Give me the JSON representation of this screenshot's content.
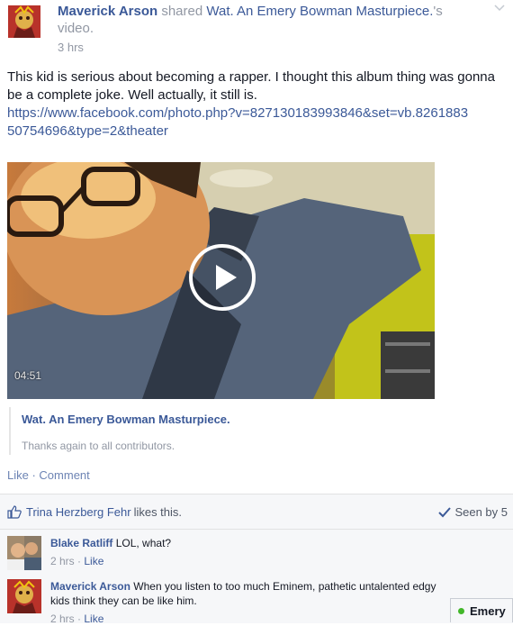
{
  "post": {
    "author": "Maverick Arson",
    "shared_text": " shared ",
    "page_name": "Wat. An Emery Bowman Masturpiece.",
    "video_suffix": "'s video.",
    "time": "3 hrs",
    "body": "This kid is serious about becoming a rapper. I thought this album thing was gonna be a complete joke. Well actually, it still is.",
    "url": "https://www.facebook.com/photo.php?v=827130183993846&set=vb.826188350754696&type=2&theater"
  },
  "video": {
    "duration": "04:51",
    "play_icon": "play-icon"
  },
  "caption": {
    "title": "Wat. An Emery Bowman Masturpiece.",
    "description": "Thanks again to all contributors."
  },
  "actions": {
    "like": "Like",
    "separator": " · ",
    "comment": "Comment"
  },
  "ufi": {
    "liker": "Trina Herzberg Fehr",
    "likes_text": "likes this.",
    "seen": "Seen by 5"
  },
  "comments": [
    {
      "name": "Blake Ratliff",
      "text": "LOL, what?",
      "time": "2 hrs",
      "like": "Like"
    },
    {
      "name": "Maverick Arson",
      "text": "When you listen to too much Eminem, pathetic untalented edgy kids think they can be like him.",
      "time": "2 hrs",
      "like": "Like"
    }
  ],
  "chat": {
    "label": "Emery"
  },
  "colors": {
    "link": "#3b5998",
    "muted": "#9197a3",
    "online": "#42b72a"
  }
}
